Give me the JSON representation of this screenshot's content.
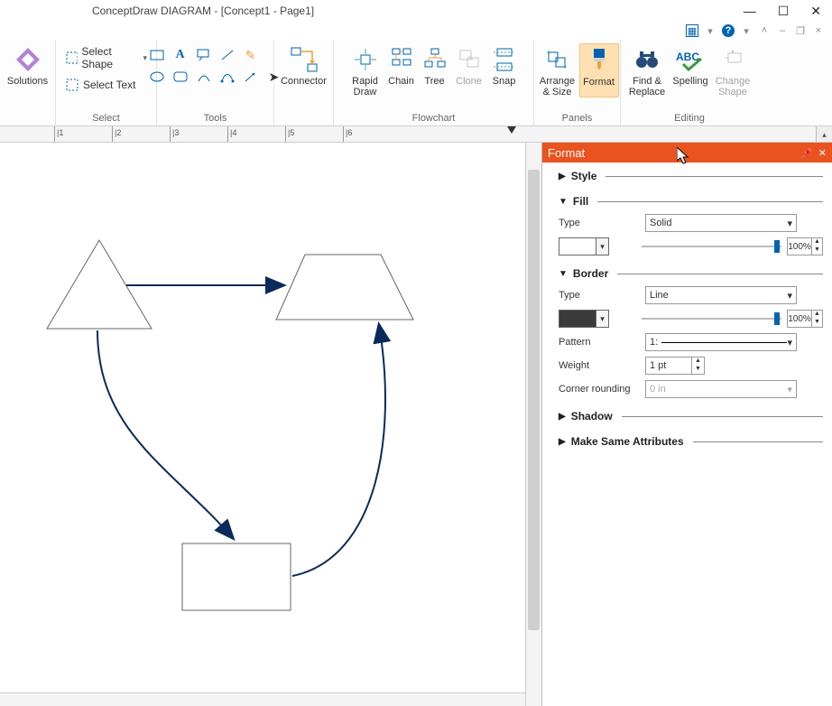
{
  "window": {
    "title": "ConceptDraw DIAGRAM - [Concept1 - Page1]"
  },
  "ribbon": {
    "solutions": {
      "label": "Solutions"
    },
    "select": {
      "shape_label": "Select Shape",
      "text_label": "Select Text",
      "group": "Select"
    },
    "tools": {
      "group": "Tools"
    },
    "connector": {
      "label": "Connector"
    },
    "flowchart": {
      "rapid": "Rapid\nDraw",
      "chain": "Chain",
      "tree": "Tree",
      "clone": "Clone",
      "snap": "Snap",
      "group": "Flowchart"
    },
    "panels": {
      "arrange": "Arrange\n& Size",
      "format": "Format",
      "group": "Panels"
    },
    "editing": {
      "find": "Find &\nReplace",
      "spelling": "Spelling",
      "change": "Change\nShape",
      "group": "Editing"
    }
  },
  "ruler": {
    "ticks": [
      "|1",
      "|2",
      "|3",
      "|4",
      "|5",
      "|6"
    ]
  },
  "panel": {
    "title": "Format",
    "style": {
      "title": "Style"
    },
    "fill": {
      "title": "Fill",
      "type_label": "Type",
      "type_value": "Solid",
      "opacity": "100%"
    },
    "border": {
      "title": "Border",
      "type_label": "Type",
      "type_value": "Line",
      "opacity": "100%",
      "color": "#3a3a3a",
      "pattern_label": "Pattern",
      "pattern_value": "1:",
      "weight_label": "Weight",
      "weight_value": "1 pt",
      "corner_label": "Corner rounding",
      "corner_value": "0 in"
    },
    "shadow": {
      "title": "Shadow"
    },
    "same": {
      "title": "Make Same Attributes"
    }
  },
  "diagram": {
    "comment": "Triangle, trapezoid, rectangle connected by dark-blue arrows",
    "stroke": "#264b7a",
    "arrow_stroke": "#0a2a5c"
  }
}
